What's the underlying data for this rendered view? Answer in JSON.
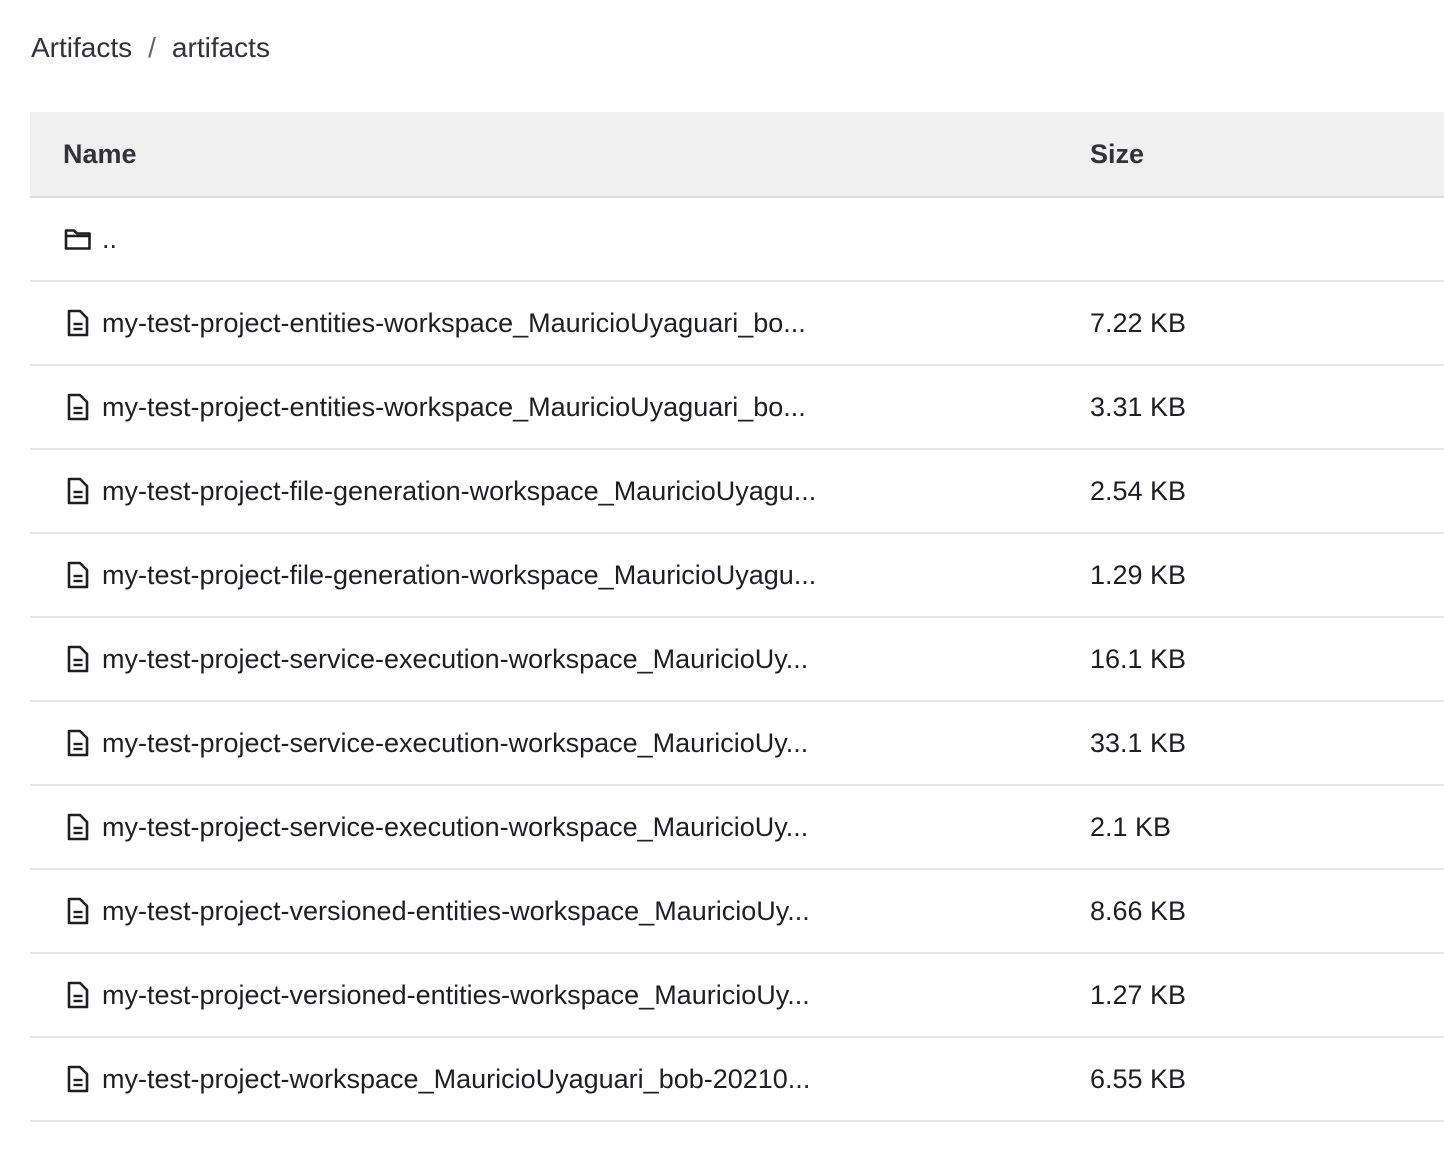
{
  "breadcrumb": {
    "root": "Artifacts",
    "separator": "/",
    "current": "artifacts"
  },
  "table": {
    "headers": {
      "name": "Name",
      "size": "Size"
    },
    "parent_link": "..",
    "rows": [
      {
        "name": "my-test-project-entities-workspace_MauricioUyaguari_bo...",
        "size": "7.22 KB"
      },
      {
        "name": "my-test-project-entities-workspace_MauricioUyaguari_bo...",
        "size": "3.31 KB"
      },
      {
        "name": "my-test-project-file-generation-workspace_MauricioUyagu...",
        "size": "2.54 KB"
      },
      {
        "name": "my-test-project-file-generation-workspace_MauricioUyagu...",
        "size": "1.29 KB"
      },
      {
        "name": "my-test-project-service-execution-workspace_MauricioUy...",
        "size": "16.1 KB"
      },
      {
        "name": "my-test-project-service-execution-workspace_MauricioUy...",
        "size": "33.1 KB"
      },
      {
        "name": "my-test-project-service-execution-workspace_MauricioUy...",
        "size": "2.1 KB"
      },
      {
        "name": "my-test-project-versioned-entities-workspace_MauricioUy...",
        "size": "8.66 KB"
      },
      {
        "name": "my-test-project-versioned-entities-workspace_MauricioUy...",
        "size": "1.27 KB"
      },
      {
        "name": "my-test-project-workspace_MauricioUyaguari_bob-20210...",
        "size": "6.55 KB"
      }
    ]
  },
  "icons": {
    "parent": "folder-icon",
    "file": "file-icon"
  }
}
